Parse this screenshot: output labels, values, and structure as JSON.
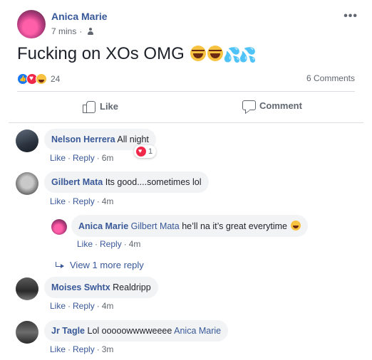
{
  "post": {
    "author": "Anica Marie",
    "time": "7 mins",
    "time_separator": "·",
    "privacy_icon": "friends-icon",
    "text": "Fucking on XOs OMG",
    "text_emojis": [
      "laughing-tears",
      "laughing-tears",
      "sweat-drops",
      "sweat-drops"
    ],
    "reaction_count": "24",
    "reaction_types": [
      "like",
      "love",
      "haha"
    ],
    "comments_count_label": "6 Comments",
    "more_icon": "•••"
  },
  "actions": {
    "like_label": "Like",
    "comment_label": "Comment"
  },
  "comments": [
    {
      "name": "Nelson Herrera",
      "text": "All night",
      "like": "Like",
      "reply": "Reply",
      "sep": "·",
      "time": "6m",
      "reaction_count": "1"
    },
    {
      "name": "Gilbert Mata",
      "text": "Its good....sometimes lol",
      "like": "Like",
      "reply": "Reply",
      "sep": "·",
      "time": "4m"
    },
    {
      "name": "Anica Marie",
      "mention": "Gilbert Mata",
      "text": "he’ll na it’s great everytime",
      "like": "Like",
      "reply": "Reply",
      "sep": "·",
      "time": "4m"
    },
    {
      "name": "Moises Swhtx",
      "text": "Realdripp",
      "like": "Like",
      "reply": "Reply",
      "sep": "·",
      "time": "4m"
    },
    {
      "name": "Jr Tagle",
      "text": "Lol ooooowwwweeee",
      "mention": "Anica Marie",
      "like": "Like",
      "reply": "Reply",
      "sep": "·",
      "time": "3m"
    }
  ],
  "view_more_replies": "View 1 more reply",
  "colors": {
    "link": "#385898",
    "meta": "#616770",
    "bubble": "#f2f3f5",
    "like_blue": "#1877f2",
    "love_red": "#f0284a",
    "haha_yellow": "#f7c23f"
  }
}
